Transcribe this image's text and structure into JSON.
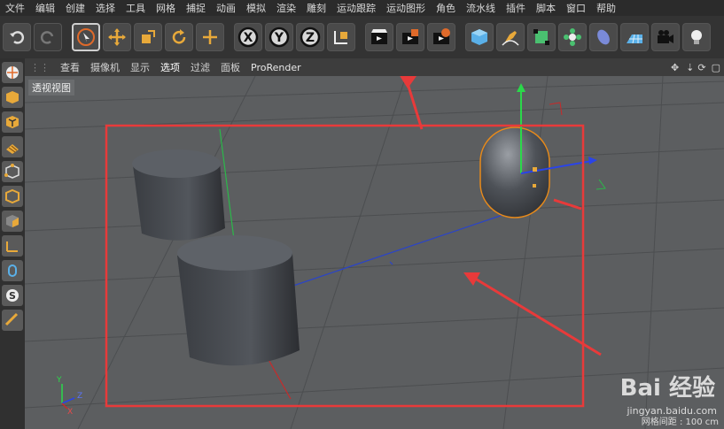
{
  "menu": [
    "文件",
    "编辑",
    "创建",
    "选择",
    "工具",
    "网格",
    "捕捉",
    "动画",
    "模拟",
    "渲染",
    "雕刻",
    "运动跟踪",
    "运动图形",
    "角色",
    "流水线",
    "插件",
    "脚本",
    "窗口",
    "帮助"
  ],
  "toolbar": {
    "icons": [
      "undo-icon",
      "redo-icon",
      "live-select-icon",
      "move-icon",
      "scale-icon",
      "rotate-icon",
      "recent-tool-icon",
      "x-axis-icon",
      "y-axis-icon",
      "z-axis-icon",
      "coordinate-system-icon",
      "render-view-icon",
      "render-picture-viewer-icon",
      "edit-render-settings-icon",
      "cube-icon",
      "pen-icon",
      "subdivision-icon",
      "array-icon",
      "deformer-icon",
      "floor-icon",
      "camera-icon",
      "light-icon"
    ]
  },
  "viewport_menu": [
    "查看",
    "摄像机",
    "显示",
    "选项",
    "过滤",
    "面板",
    "ProRender"
  ],
  "viewport": {
    "label": "透视视图",
    "grid_spacing": "网格间距 : 100 cm",
    "axes": [
      "Y",
      "Z",
      "X"
    ]
  },
  "watermark": {
    "logo": "Bai 经验",
    "url": "jingyan.baidu.com"
  },
  "colors": {
    "annotation": "#e83a3a",
    "selection": "#e88a1a"
  }
}
